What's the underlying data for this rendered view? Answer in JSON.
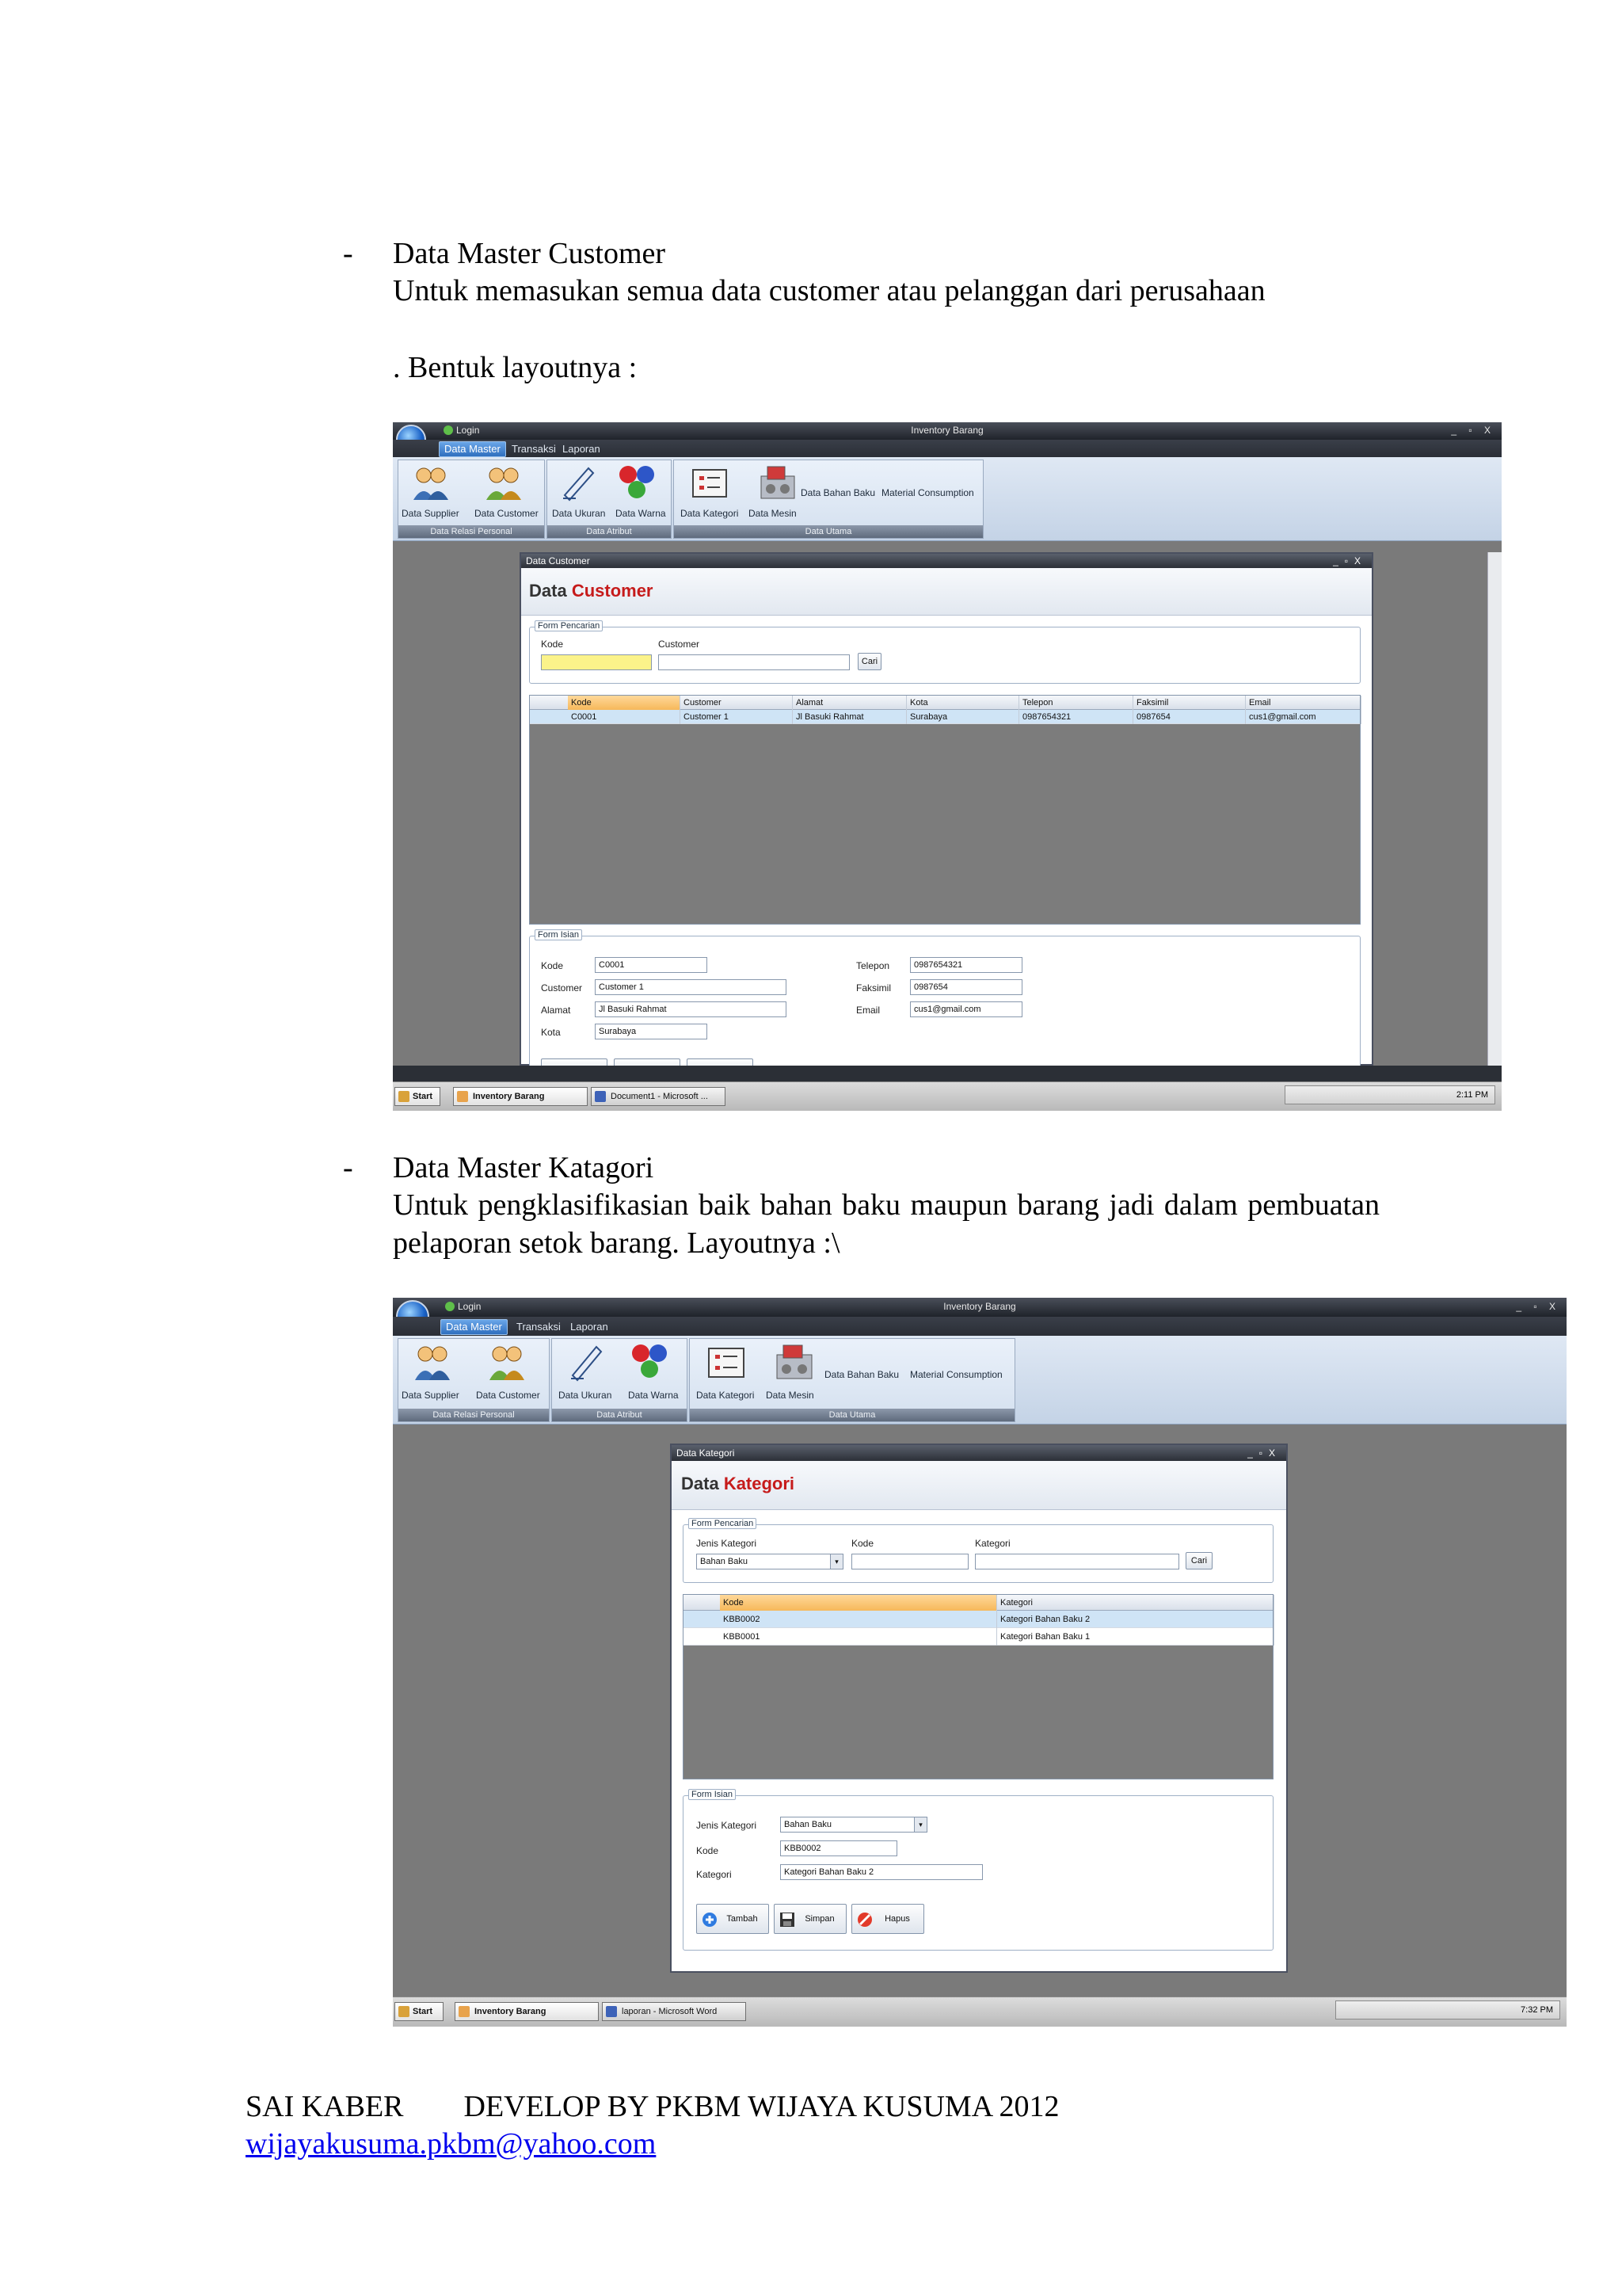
{
  "sections": [
    {
      "bullet": "-",
      "title": "Data Master Customer",
      "line1": "Untuk memasukan semua data customer atau pelanggan dari perusahaan",
      "line2": ". Bentuk layoutnya :"
    },
    {
      "bullet": "-",
      "title": "Data Master Katagori",
      "paragraph": "Untuk pengklasifikasian baik bahan baku maupun barang jadi dalam pembuatan pelaporan setok barang. Layoutnya :\\"
    }
  ],
  "app": {
    "login_label": "Login",
    "title": "Inventory Barang",
    "window_controls": "_ ▫ X",
    "menu": [
      "Data Master",
      "Transaksi",
      "Laporan"
    ],
    "ribbon": {
      "buttons": [
        "Data Supplier",
        "Data Customer",
        "Data Ukuran",
        "Data Warna",
        "Data Kategori",
        "Data Mesin",
        "Data Bahan Baku",
        "Material Consumption"
      ],
      "groups": [
        "Data Relasi Personal",
        "Data Atribut",
        "Data Utama"
      ]
    }
  },
  "customer_window": {
    "title": "Data Customer",
    "heading_plain": "Data",
    "heading_accent": "Customer",
    "search_legend": "Form Pencarian",
    "search_labels": [
      "Kode",
      "Customer"
    ],
    "search_button": "Cari",
    "columns": [
      "Kode",
      "Customer",
      "Alamat",
      "Kota",
      "Telepon",
      "Faksimil",
      "Email"
    ],
    "rows": [
      [
        "C0001",
        "Customer 1",
        "Jl Basuki Rahmat",
        "Surabaya",
        "0987654321",
        "0987654",
        "cus1@gmail.com"
      ]
    ],
    "form_legend": "Form Isian",
    "form_left": [
      {
        "label": "Kode",
        "value": "C0001"
      },
      {
        "label": "Customer",
        "value": "Customer 1"
      },
      {
        "label": "Alamat",
        "value": "Jl Basuki Rahmat"
      },
      {
        "label": "Kota",
        "value": "Surabaya"
      }
    ],
    "form_right": [
      {
        "label": "Telepon",
        "value": "0987654321"
      },
      {
        "label": "Faksimil",
        "value": "0987654"
      },
      {
        "label": "Email",
        "value": "cus1@gmail.com"
      }
    ]
  },
  "kategori_window": {
    "title": "Data Kategori",
    "heading_plain": "Data",
    "heading_accent": "Kategori",
    "search_legend": "Form Pencarian",
    "search_labels": [
      "Jenis Kategori",
      "Kode",
      "Kategori"
    ],
    "search_jenis_value": "Bahan Baku",
    "search_button": "Cari",
    "columns": [
      "Kode",
      "Kategori"
    ],
    "rows": [
      [
        "KBB0002",
        "Kategori Bahan Baku 2"
      ],
      [
        "KBB0001",
        "Kategori Bahan Baku 1"
      ]
    ],
    "form_legend": "Form Isian",
    "form": [
      {
        "label": "Jenis Kategori",
        "value": "Bahan Baku"
      },
      {
        "label": "Kode",
        "value": "KBB0002"
      },
      {
        "label": "Kategori",
        "value": "Kategori Bahan Baku 2"
      }
    ],
    "buttons": [
      "Tambah",
      "Simpan",
      "Hapus"
    ]
  },
  "taskbars": [
    {
      "start": "Start",
      "items": [
        "Inventory Barang",
        "Document1 - Microsoft ..."
      ],
      "time": "2:11 PM"
    },
    {
      "start": "Start",
      "items": [
        "Inventory Barang",
        "laporan - Microsoft Word"
      ],
      "time": "7:32 PM"
    }
  ],
  "footer": {
    "line": "SAI KABER        DEVELOP BY PKBM WIJAYA KUSUMA 2012",
    "email": "wijayakusuma.pkbm@yahoo.com"
  },
  "colors": {
    "accent_red": "#c61b1b",
    "link_blue": "#0000ee",
    "search_highlight": "#fbf38a"
  }
}
